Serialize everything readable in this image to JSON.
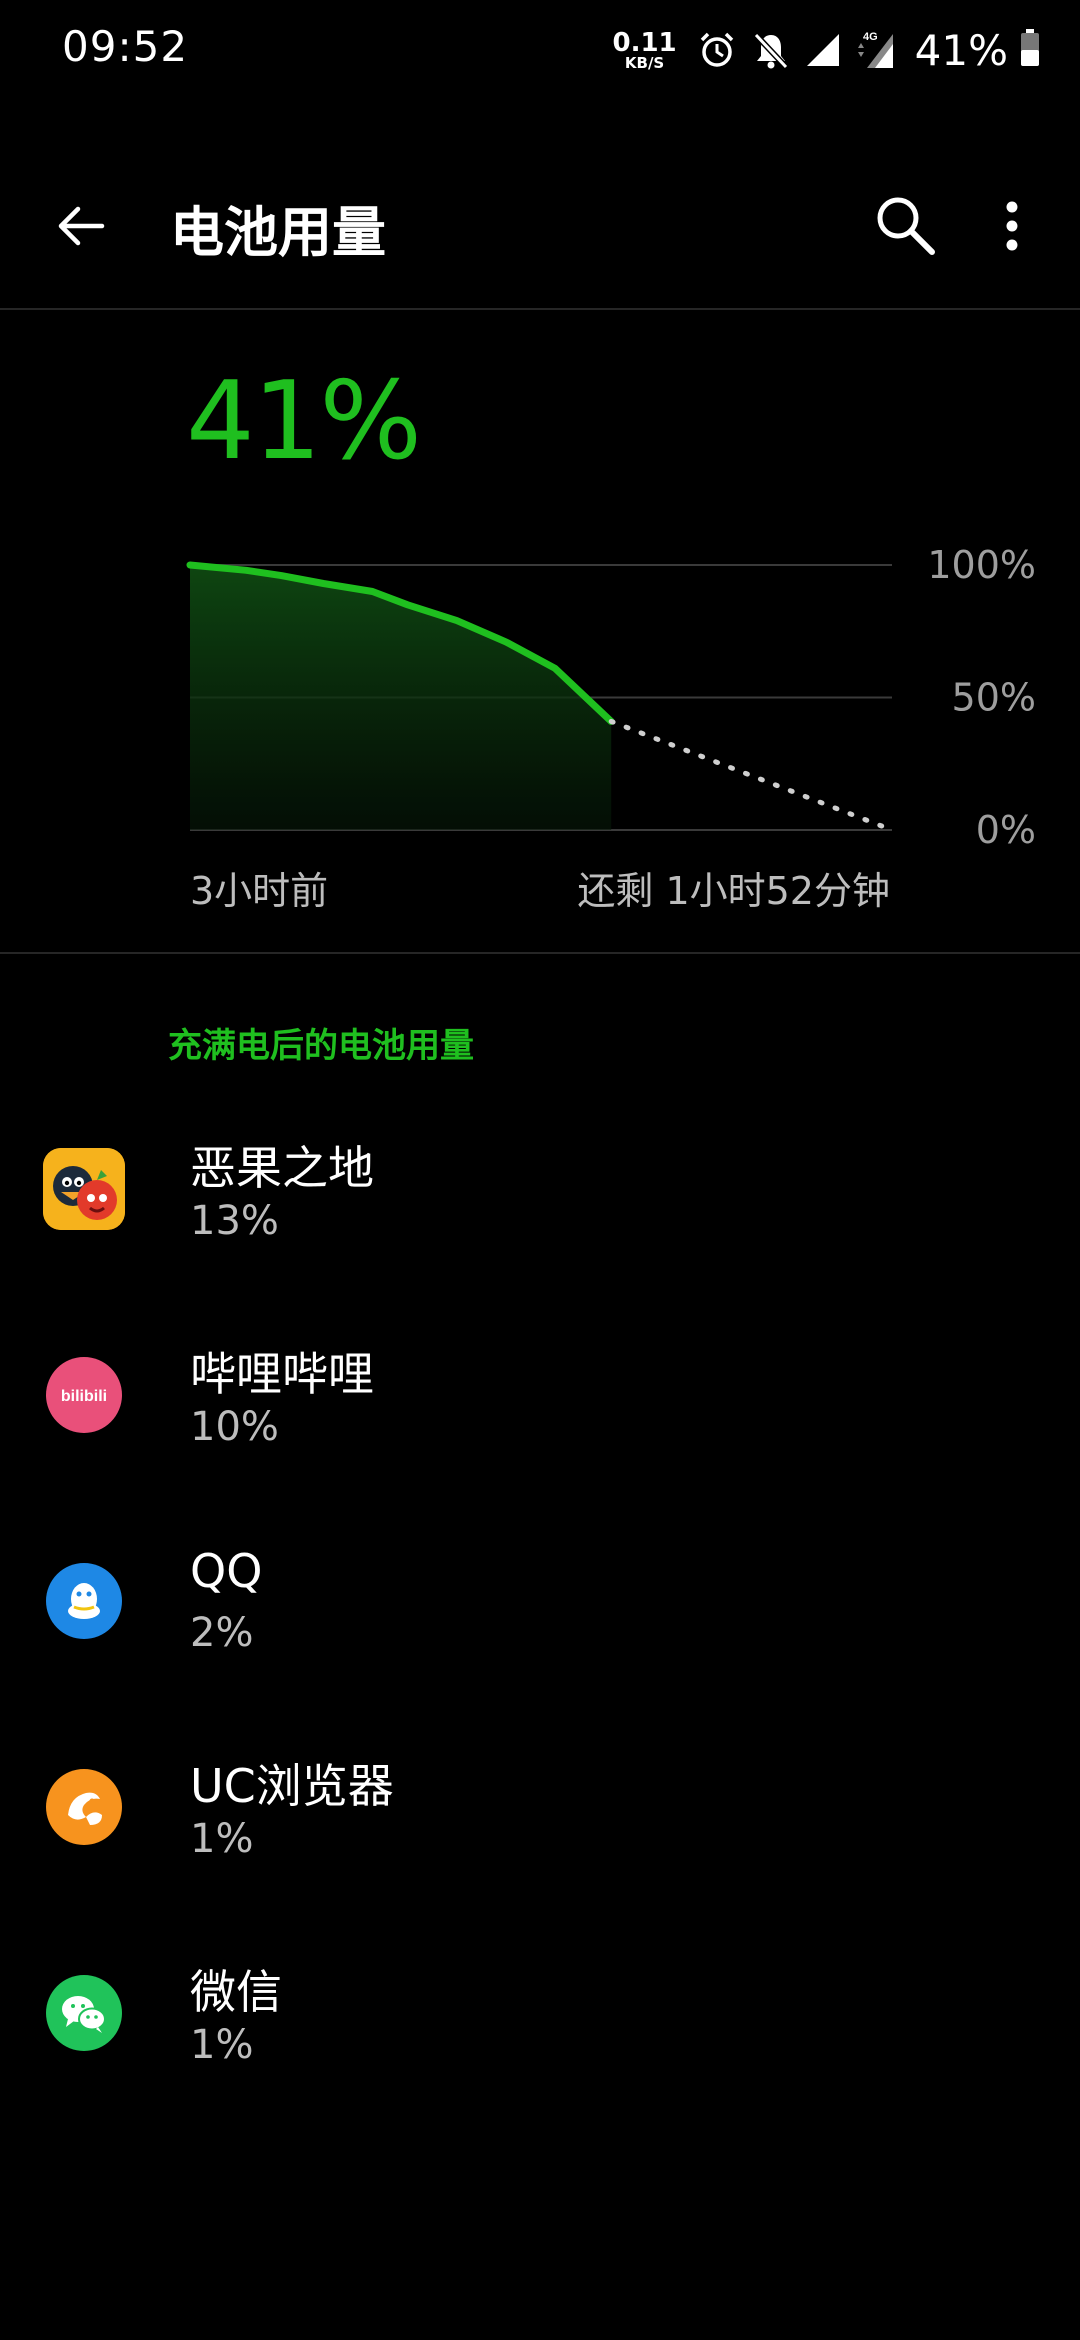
{
  "status_bar": {
    "time": "09:52",
    "net_speed_value": "0.11",
    "net_speed_unit": "KB/S",
    "network_type": "4G",
    "battery_percent": "41%",
    "icons": [
      "alarm-icon",
      "notifications-off-icon",
      "signal-icon",
      "signal-4g-icon",
      "battery-icon"
    ]
  },
  "app_bar": {
    "title": "电池用量",
    "icons": [
      "back-arrow-icon",
      "search-icon",
      "more-vert-icon"
    ]
  },
  "battery": {
    "level": "41%",
    "chart_axis": [
      "100%",
      "50%",
      "0%"
    ],
    "label_start": "3小时前",
    "label_end": "还剩 1小时52分钟",
    "accent_color": "#1fbf1f"
  },
  "chart_data": {
    "type": "line",
    "x_start_label": "3小时前",
    "x_end_label": "还剩 1小时52分钟",
    "ylim": [
      0,
      100
    ],
    "y_ticks": [
      "100%",
      "50%",
      "0%"
    ],
    "series": [
      {
        "kind": "actual",
        "x": [
          0,
          0.08,
          0.13,
          0.19,
          0.26,
          0.31,
          0.38,
          0.45,
          0.52,
          0.6
        ],
        "values": [
          100,
          98,
          96,
          93,
          90,
          85,
          79,
          71,
          61,
          41
        ]
      },
      {
        "kind": "projected",
        "x": [
          0.6,
          1.0
        ],
        "values": [
          41,
          0
        ]
      }
    ],
    "grid": true
  },
  "section": {
    "title": "充满电后的电池用量"
  },
  "apps": [
    {
      "name": "恶果之地",
      "usage": "13%",
      "icon": "game-app-icon",
      "color": "#f6b21c"
    },
    {
      "name": "哔哩哔哩",
      "usage": "10%",
      "icon": "bilibili-icon",
      "color": "#e9507a",
      "icon_text": "bilibili"
    },
    {
      "name": "QQ",
      "usage": "2%",
      "icon": "qq-icon",
      "color": "#1e88e5"
    },
    {
      "name": "UC浏览器",
      "usage": "1%",
      "icon": "uc-browser-icon",
      "color": "#f7931e"
    },
    {
      "name": "微信",
      "usage": "1%",
      "icon": "wechat-icon",
      "color": "#20c35a"
    }
  ]
}
